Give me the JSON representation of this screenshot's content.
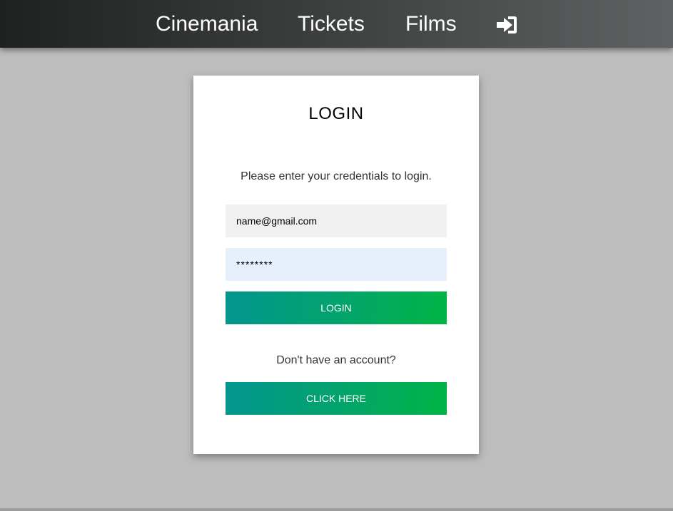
{
  "nav": {
    "brand": "Cinemania",
    "tickets": "Tickets",
    "films": "Films",
    "login_icon": "sign-in-icon"
  },
  "login_form": {
    "title": "LOGIN",
    "subtitle": "Please enter your credentials to login.",
    "email_value": "name@gmail.com",
    "password_value": "********",
    "login_button": "LOGIN",
    "account_prompt": "Don't have an account?",
    "signup_button": "CLICK HERE"
  },
  "colors": {
    "navbar_start": "#1f2121",
    "navbar_end": "#5f6262",
    "background": "#bdbdbd",
    "button_start": "#02958f",
    "button_end": "#00b445"
  }
}
